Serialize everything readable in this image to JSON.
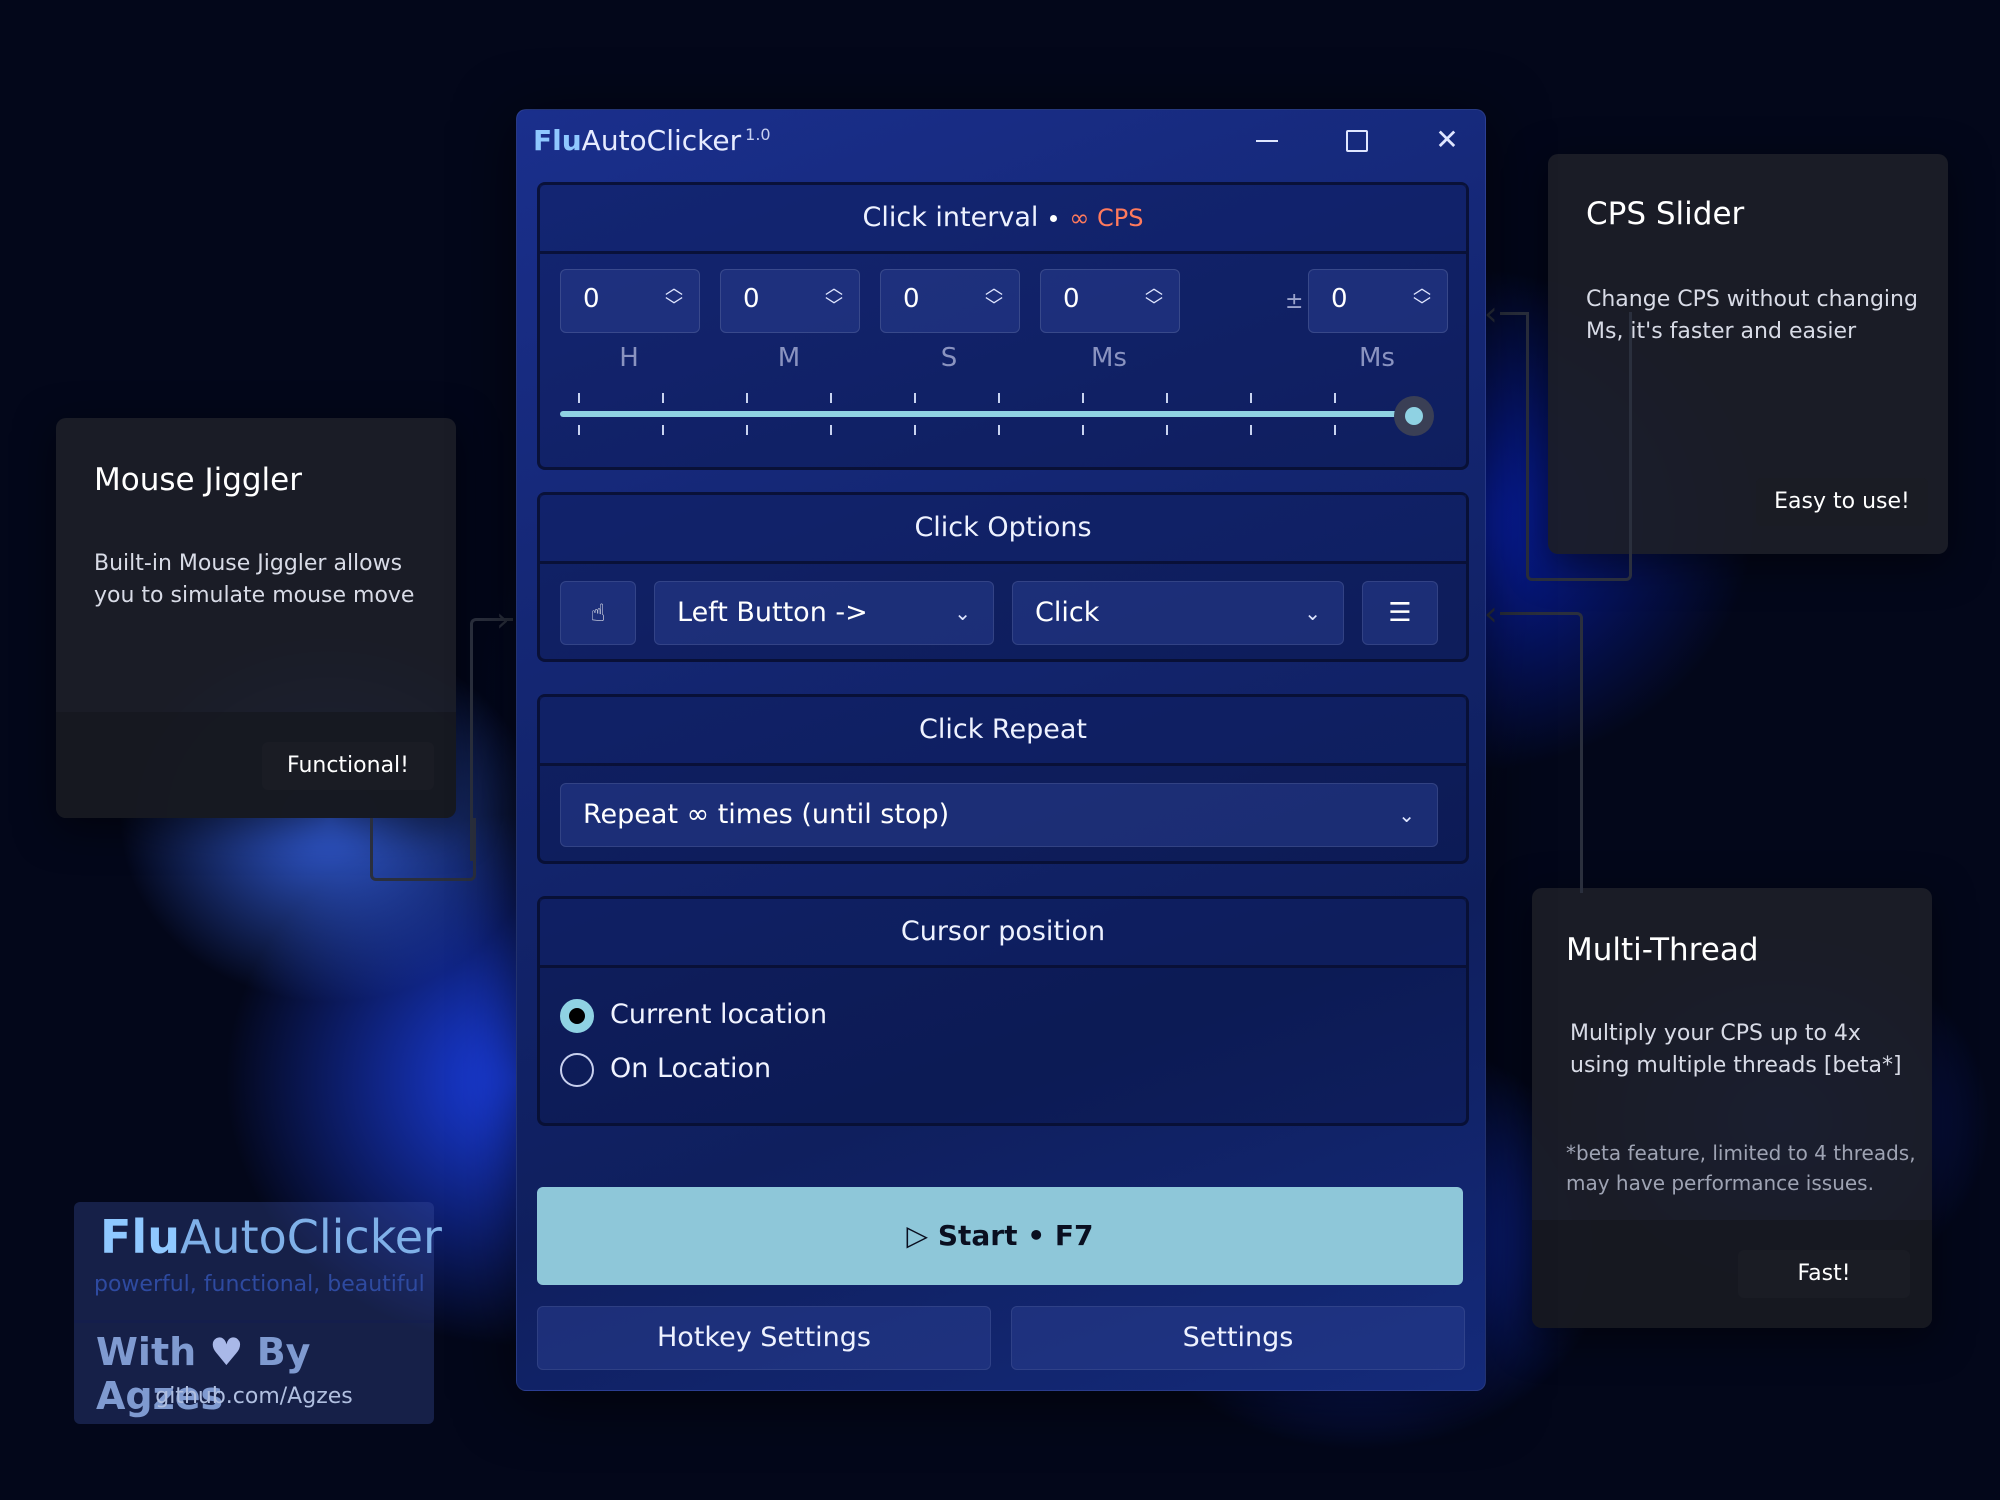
{
  "window": {
    "title_flu": "Flu",
    "title_rest": "AutoClicker",
    "version": "1.0",
    "min_icon": "minimize-icon",
    "max_icon": "maximize-icon",
    "close_icon": "close-icon"
  },
  "click_interval": {
    "heading": "Click interval",
    "cps": "∞ CPS",
    "fields": [
      {
        "value": "0",
        "unit": "H"
      },
      {
        "value": "0",
        "unit": "M"
      },
      {
        "value": "0",
        "unit": "S"
      },
      {
        "value": "0",
        "unit": "Ms"
      }
    ],
    "random_symbol": "±",
    "random": {
      "value": "0",
      "unit": "Ms"
    },
    "slider_level": 1.0
  },
  "click_options": {
    "heading": "Click Options",
    "mouse_button": "Left Button ->",
    "click_type": "Click"
  },
  "click_repeat": {
    "heading": "Click Repeat",
    "selected": "Repeat ∞ times (until stop)"
  },
  "cursor_position": {
    "heading": "Cursor position",
    "options": [
      "Current location",
      "On Location"
    ],
    "selected_index": 0
  },
  "start_button": "Start • F7",
  "bottom_buttons": {
    "hotkey": "Hotkey Settings",
    "settings": "Settings"
  },
  "cards": {
    "mouse_jiggler": {
      "title": "Mouse Jiggler",
      "text": "Built-in Mouse Jiggler allows you to simulate mouse move",
      "footer": "Functional!"
    },
    "cps_slider": {
      "title": "CPS Slider",
      "text": "Change CPS without changing Ms, it's faster and easier",
      "footer": "Easy to use!"
    },
    "multi_thread": {
      "title": "Multi-Thread",
      "text": "Multiply your CPS up to 4x using multiple threads [beta*]",
      "note": "*beta feature, limited to 4 threads, may have performance issues.",
      "footer": "Fast!"
    }
  },
  "brand": {
    "name_flu": "Flu",
    "name_rest": "AutoClicker",
    "tagline": "powerful, functional, beautiful",
    "with": "With",
    "by": "By Agzes",
    "github": "github.com/Agzes"
  },
  "colors": {
    "accent": "#8ec7d9",
    "cps": "#ff7a5c",
    "window": "#13256f"
  }
}
